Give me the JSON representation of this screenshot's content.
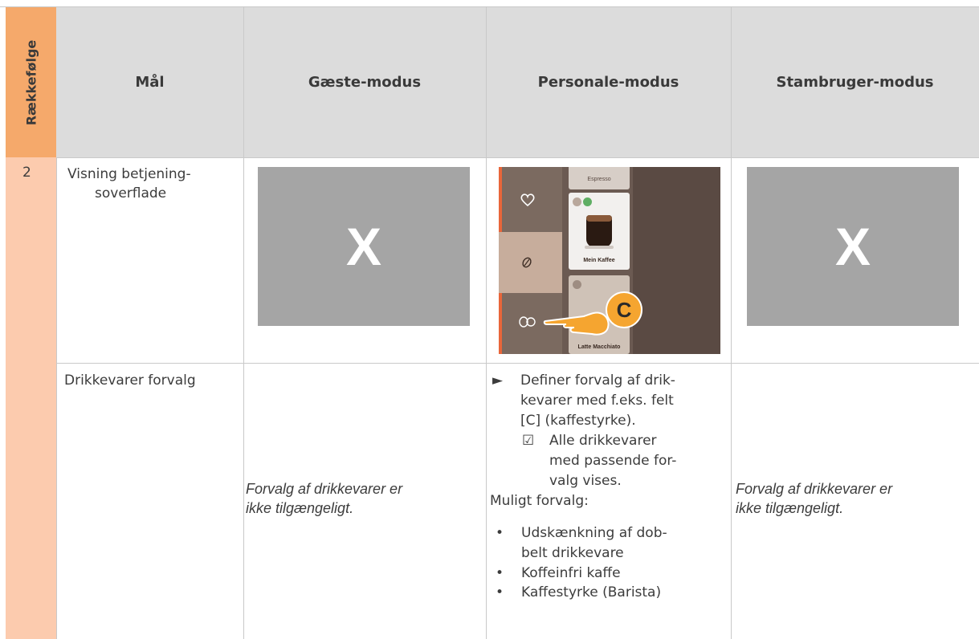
{
  "header": {
    "sequence_label": "Rækkefølge",
    "goal": "Mål",
    "guest_mode": "Gæste-modus",
    "staff_mode": "Personale-modus",
    "regular_mode": "Stambruger-modus"
  },
  "rows": {
    "number": "2",
    "display": {
      "goal_line1": "Visning betjening-",
      "goal_line2": "soverflade",
      "guest_mark": "X",
      "regular_mark": "X",
      "screen": {
        "tile_top_label": "Espresso",
        "tile_mid_label": "Mein Kaffee",
        "tile_bottom_label": "Latte Macchiato",
        "marker": "C"
      }
    },
    "preselect": {
      "goal": "Drikkevarer forvalg",
      "guest_note_line1": "Forvalg af drikkevarer er",
      "guest_note_line2": "ikke tilgængeligt.",
      "regular_note_line1": "Forvalg af drikkevarer er",
      "regular_note_line2": "ikke tilgængeligt.",
      "staff": {
        "step_marker": "►",
        "step_lines": [
          "Definer forvalg af drik-",
          "kevarer med f.eks. felt",
          "[C] (kaffestyrke)."
        ],
        "result_marker": "☑",
        "result_lines": [
          "Alle drikkevarer",
          "med passende for-",
          "valg vises."
        ],
        "options_title": "Muligt forvalg:",
        "bullet": "•",
        "options": [
          {
            "line1": "Udskænkning af dob-",
            "line2": "belt drikkevare"
          },
          {
            "line1": "Koffeinfri kaffe",
            "line2": ""
          },
          {
            "line1": "Kaffestyrke (Barista)",
            "line2": ""
          }
        ]
      }
    }
  },
  "colors": {
    "accent_orange": "#f5a96b",
    "light_orange": "#fccbae",
    "header_grey": "#dcdcdc",
    "placeholder_grey": "#a5a5a5"
  }
}
